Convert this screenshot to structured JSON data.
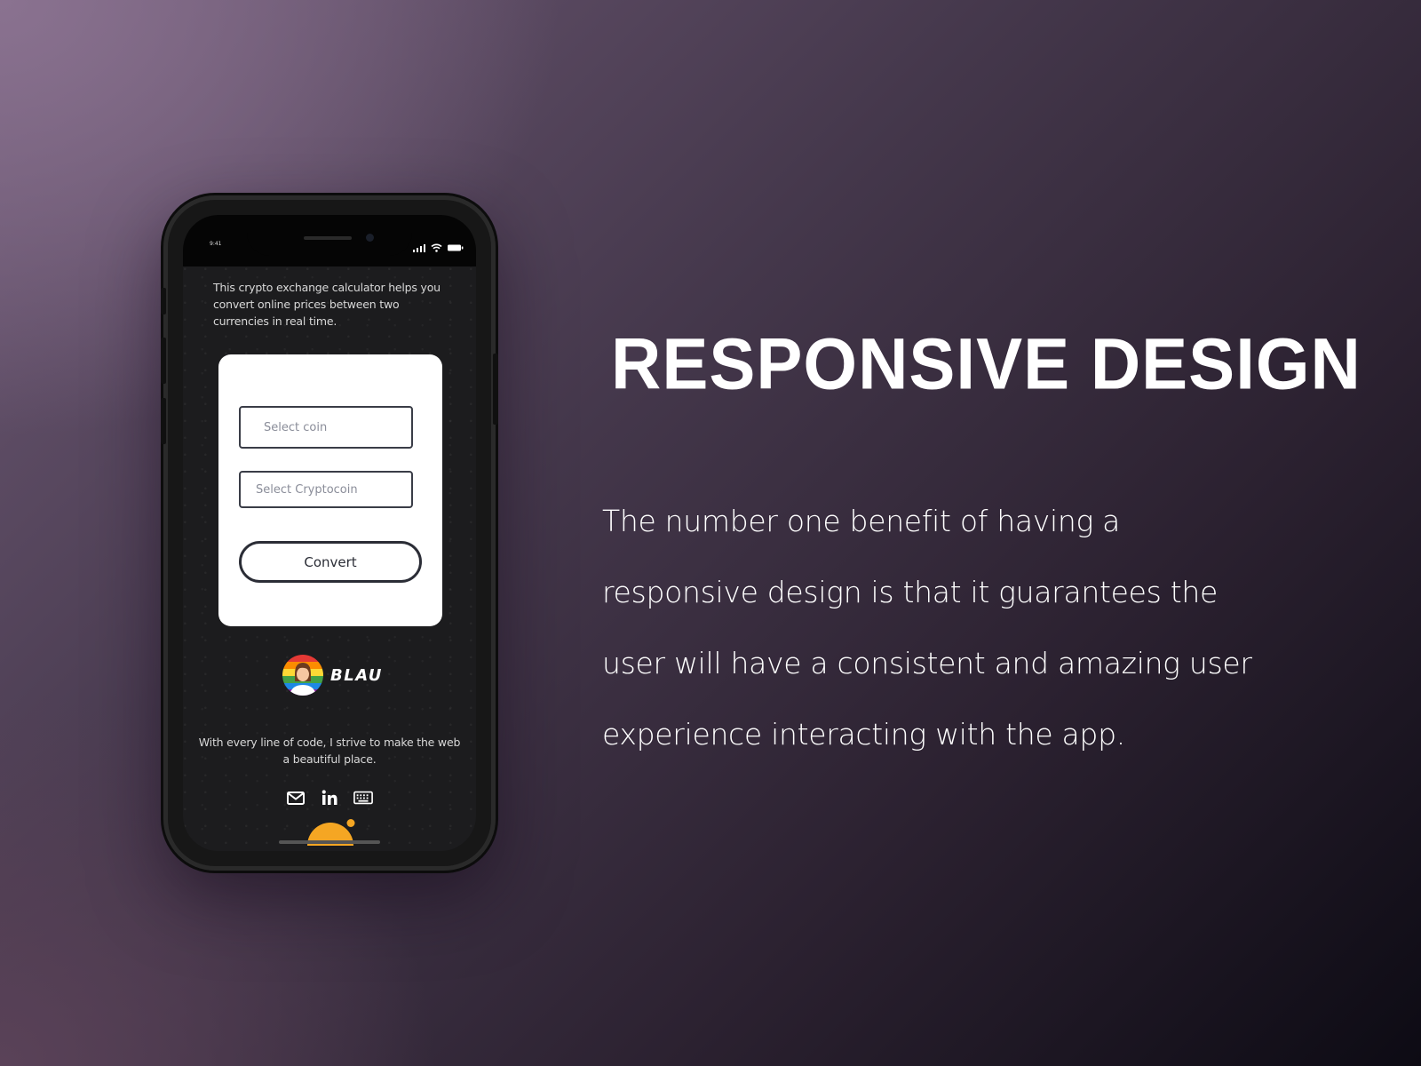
{
  "phone": {
    "status_time": "9:41",
    "intro_text": "This crypto exchange calculator helps you convert online prices between two currencies in real time.",
    "form": {
      "coin_placeholder": "Select coin",
      "crypto_placeholder": "Select Cryptocoin",
      "convert_label": "Convert"
    },
    "brand_name": "BLAU",
    "tagline": "With every line of code, I strive to make the web a beautiful place.",
    "social_icons": [
      "mail-icon",
      "linkedin-icon",
      "keyboard-icon"
    ],
    "accent_color": "#f5a623"
  },
  "headline": "RESPONSIVE DESIGN",
  "body_text": "The number one benefit of having a responsive design is that it guarantees the user will have a consistent and amazing user experience interacting with the app."
}
